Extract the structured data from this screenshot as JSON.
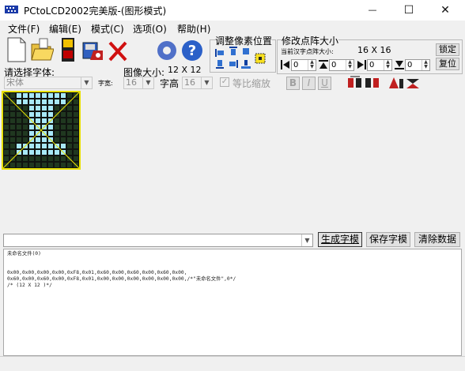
{
  "window": {
    "title": "PCtoLCD2002完美版-(图形模式)",
    "minimize": "—",
    "maximize": "☐",
    "close": "✕"
  },
  "menu": {
    "file": "文件(F)",
    "edit": "编辑(E)",
    "mode": "模式(C)",
    "options": "选项(O)",
    "help": "帮助(H)"
  },
  "align_group": {
    "label": "调整像素位置"
  },
  "resize_group": {
    "label": "修改点阵大小",
    "current_label": "当前汉字点阵大小:",
    "current_size": "16 X 16",
    "lock_button": "锁定",
    "restore_button": "复位",
    "spin_values": [
      "0",
      "0",
      "0",
      "0"
    ]
  },
  "font_row": {
    "choose_font_label": "请选择字体:",
    "font_value": "宋体",
    "char_width_label": "字宽:",
    "char_width_value": "16",
    "image_size_label": "图像大小:",
    "image_size_value": "12 X 12",
    "char_height_label": "字高",
    "char_height_value": "16",
    "scale_checkbox_label": "等比缩放",
    "bold_button": "B",
    "italic_button": "I",
    "underline_button": "U"
  },
  "bottom": {
    "generate_button": "生成字模",
    "save_button": "保存字模",
    "clear_button": "清除数据",
    "output_lines": [
      "未命名文件(0)",
      "",
      "",
      "0x00,0x00,0x00,0x00,0xF8,0x01,0x60,0x00,0x60,0x00,0x60,0x00,",
      "0x60,0x00,0x60,0x00,0xF8,0x01,0x00,0x00,0x00,0x00,0x00,0x00,/*\"未命名文件\",0*/",
      "/* (12 X 12 )*/"
    ]
  },
  "pixel_grid": {
    "cols": 12,
    "rows": 12,
    "on_color": "#a8e8f8",
    "off_color": "#203820",
    "on_rows": [
      [
        2,
        3,
        4,
        5,
        6,
        7,
        8,
        9
      ],
      [
        2,
        3,
        4,
        5,
        6,
        7,
        8,
        9
      ],
      [
        4,
        5,
        6,
        7
      ],
      [
        4,
        5,
        6,
        7
      ],
      [
        4,
        5,
        6,
        7
      ],
      [
        4,
        5,
        6,
        7
      ],
      [
        4,
        5,
        6,
        7
      ],
      [
        4,
        5,
        6,
        7
      ],
      [
        2,
        3,
        4,
        5,
        6,
        7,
        8,
        9
      ],
      [
        2,
        3,
        4,
        5,
        6,
        7,
        8,
        9
      ],
      [],
      []
    ]
  }
}
